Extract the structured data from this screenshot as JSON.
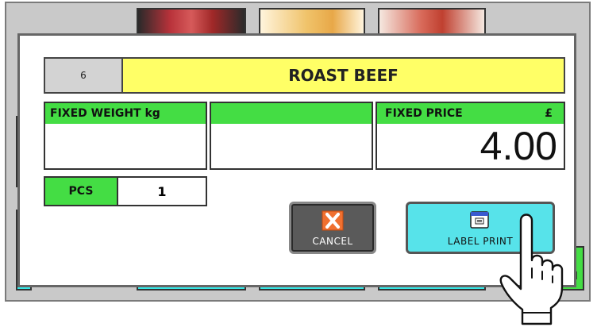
{
  "background": {
    "right_button_label": "CH"
  },
  "dialog": {
    "plu_number": "6",
    "item_name": "ROAST BEEF",
    "fixed_weight": {
      "label": "FIXED WEIGHT kg",
      "value": ""
    },
    "middle_field": {
      "label": "",
      "value": ""
    },
    "fixed_price": {
      "label": "FIXED PRICE",
      "currency": "£",
      "value": "4.00"
    },
    "pcs": {
      "label": "PCS",
      "value": "1"
    },
    "cancel_button": {
      "label": "CANCEL"
    },
    "print_button": {
      "label": "LABEL PRINT"
    }
  },
  "colors": {
    "header_yellow": "#ffff66",
    "label_green": "#44dd44",
    "cyan_button": "#57e3ea",
    "cancel_gray": "#5a5a5a",
    "cancel_x": "#f07030"
  },
  "icons": [
    "cancel-x-icon",
    "printer-icon",
    "pointing-hand-icon"
  ]
}
